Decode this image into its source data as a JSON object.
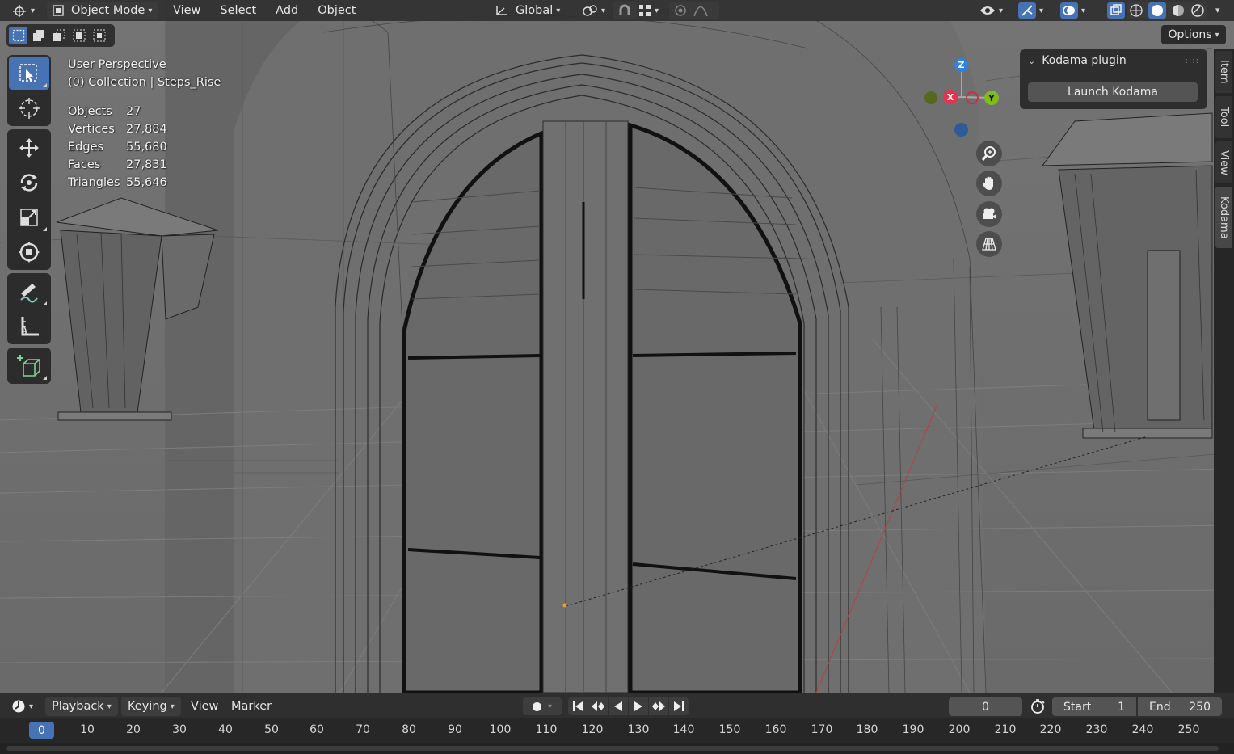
{
  "header": {
    "mode": "Object Mode",
    "menus": [
      "View",
      "Select",
      "Add",
      "Object"
    ],
    "orientation": "Global"
  },
  "options_label": "Options",
  "overlay": {
    "perspective": "User Perspective",
    "collection": "(0) Collection | Steps_Rise",
    "stats": [
      {
        "label": "Objects",
        "value": "27"
      },
      {
        "label": "Vertices",
        "value": "27,884"
      },
      {
        "label": "Edges",
        "value": "55,680"
      },
      {
        "label": "Faces",
        "value": "27,831"
      },
      {
        "label": "Triangles",
        "value": "55,646"
      }
    ]
  },
  "gizmo": {
    "x": "X",
    "y": "Y",
    "z": "Z"
  },
  "panel": {
    "title": "Kodama plugin",
    "button": "Launch Kodama",
    "tabs": [
      "Item",
      "Tool",
      "View",
      "Kodama"
    ]
  },
  "timeline": {
    "menus": [
      "Playback",
      "Keying",
      "View",
      "Marker"
    ],
    "current_frame": "0",
    "start_label": "Start",
    "start_value": "1",
    "end_label": "End",
    "end_value": "250",
    "ticks": [
      "0",
      "10",
      "20",
      "30",
      "40",
      "50",
      "60",
      "70",
      "80",
      "90",
      "100",
      "110",
      "120",
      "130",
      "140",
      "150",
      "160",
      "170",
      "180",
      "190",
      "200",
      "210",
      "220",
      "230",
      "240",
      "250"
    ]
  },
  "colors": {
    "accent": "#4772b3",
    "axis_x": "#e8324c",
    "axis_y": "#7fbb1f",
    "axis_z": "#2f83e0"
  }
}
